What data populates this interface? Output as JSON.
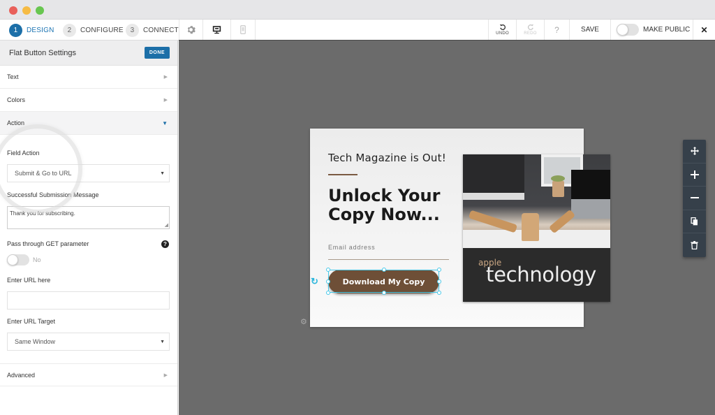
{
  "window": {
    "controls": [
      "close",
      "minimize",
      "maximize"
    ]
  },
  "toolbar": {
    "steps": [
      {
        "num": "1",
        "label": "DESIGN",
        "active": true
      },
      {
        "num": "2",
        "label": "CONFIGURE",
        "active": false
      },
      {
        "num": "3",
        "label": "CONNECT",
        "active": false
      }
    ],
    "view_icons": [
      "gear-icon",
      "desktop-icon",
      "mobile-icon"
    ],
    "undo_label": "UNDO",
    "redo_label": "REDO",
    "help_label": "?",
    "save_label": "SAVE",
    "make_public_label": "MAKE PUBLIC",
    "make_public_on": false,
    "close_label": "✕"
  },
  "sidebar": {
    "title": "Flat Button Settings",
    "done_label": "DONE",
    "sections": [
      {
        "label": "Text",
        "open": false
      },
      {
        "label": "Colors",
        "open": false
      },
      {
        "label": "Action",
        "open": true
      },
      {
        "label": "Advanced",
        "open": false
      }
    ],
    "action": {
      "field_action_label": "Field Action",
      "field_action_value": "Submit & Go to URL",
      "success_message_label": "Successful Submission Message",
      "success_message_value": "Thank you for subscribing.",
      "get_param_label": "Pass through GET parameter",
      "get_param_help": "?",
      "get_param_state": "No",
      "url_label": "Enter URL here",
      "url_value": "",
      "url_target_label": "Enter URL Target",
      "url_target_value": "Same Window"
    }
  },
  "canvas": {
    "card": {
      "eyebrow": "Tech Magazine is Out!",
      "headline_line1": "Unlock Your",
      "headline_line2": "Copy Now...",
      "email_placeholder": "Email address",
      "cta_label": "Download My Copy",
      "cover_small": "apple",
      "cover_big": "technology"
    },
    "colors": {
      "cta_bg": "#6e4f37",
      "accent_rule": "#7a5a42",
      "selection": "#46c8e8",
      "primary": "#1c6fa8"
    },
    "float_tools": [
      "move-icon",
      "add-icon",
      "remove-icon",
      "duplicate-icon",
      "delete-icon"
    ]
  }
}
